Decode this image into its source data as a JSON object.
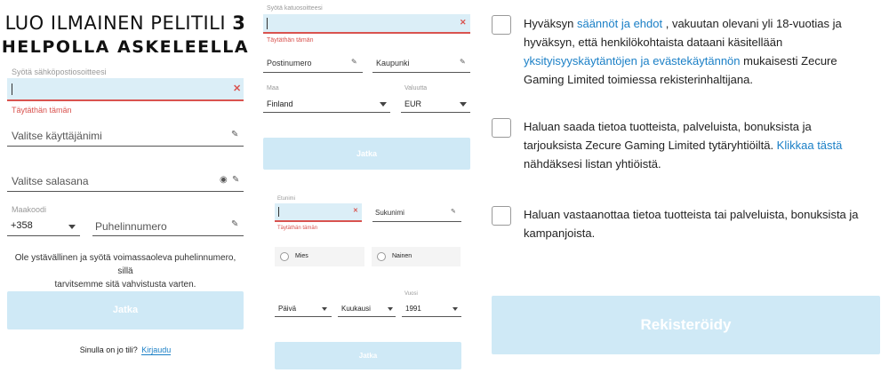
{
  "col1": {
    "title_line1": "LUO ILMAINEN PELITILI",
    "title_number": "3",
    "title_line2": "HELPOLLA ASKELEELLA",
    "email_label": "Syötä sähköpostiosoitteesi",
    "email_error": "Täytäthän tämän",
    "username_placeholder": "Valitse käyttäjänimi",
    "password_placeholder": "Valitse salasana",
    "country_code_label": "Maakoodi",
    "country_code_value": "+358",
    "phone_placeholder": "Puhelinnumero",
    "phone_note_line1": "Ole ystävällinen ja syötä voimassaoleva puhelinnumero, sillä",
    "phone_note_line2": "tarvitsemme sitä vahvistusta varten.",
    "continue_label": "Jatka",
    "login_prompt": "Sinulla on jo tili?",
    "login_link": "Kirjaudu"
  },
  "col2": {
    "street_label": "Syötä katuosoitteesi",
    "street_error": "Täytäthän tämän",
    "postcode_placeholder": "Postinumero",
    "city_placeholder": "Kaupunki",
    "country_label": "Maa",
    "country_value": "Finland",
    "currency_label": "Valuutta",
    "currency_value": "EUR",
    "continue_label": "Jatka",
    "firstname_label": "Etunimi",
    "firstname_error": "Täytäthän tämän",
    "lastname_placeholder": "Sukunimi",
    "gender_male": "Mies",
    "gender_female": "Nainen",
    "day_placeholder": "Päivä",
    "month_placeholder": "Kuukausi",
    "year_label": "Vuosi",
    "year_value": "1991",
    "continue_label_2": "Jatka"
  },
  "col3": {
    "terms_l1_a": "Hyväksyn ",
    "terms_l1_link": "säännöt ja ehdot",
    "terms_l1_b": " , vakuutan olevani yli 18-vuotias ja",
    "terms_l2": "hyväksyn, että henkilökohtaista dataani käsitellään",
    "terms_l3_link": "yksityisyyskäytäntöjen ja evästekäytännön",
    "terms_l3_b": " mukaisesti Zecure",
    "terms_l4": "Gaming Limited toimiessa rekisterinhaltijana.",
    "news_l1": "Haluan saada tietoa tuotteista, palveluista, bonuksista ja",
    "news_l2_a": "tarjouksista Zecure Gaming Limited tytäryhtiöiltä. ",
    "news_l2_link": "Klikkaa tästä",
    "news_l3": "nähdäksesi listan yhtiöistä.",
    "offers_l1": "Haluan vastaanottaa tietoa tuotteista tai palveluista, bonuksista ja",
    "offers_l2": "kampanjoista.",
    "register_label": "Rekisteröidy"
  },
  "colors": {
    "accent_link": "#1a7fc6",
    "error": "#d9534f",
    "button_disabled": "#cfe9f6",
    "field_active_bg": "#dbeef7"
  },
  "icons": [
    "clear-icon",
    "pencil-icon",
    "eye-icon",
    "dropdown-arrow-icon"
  ]
}
